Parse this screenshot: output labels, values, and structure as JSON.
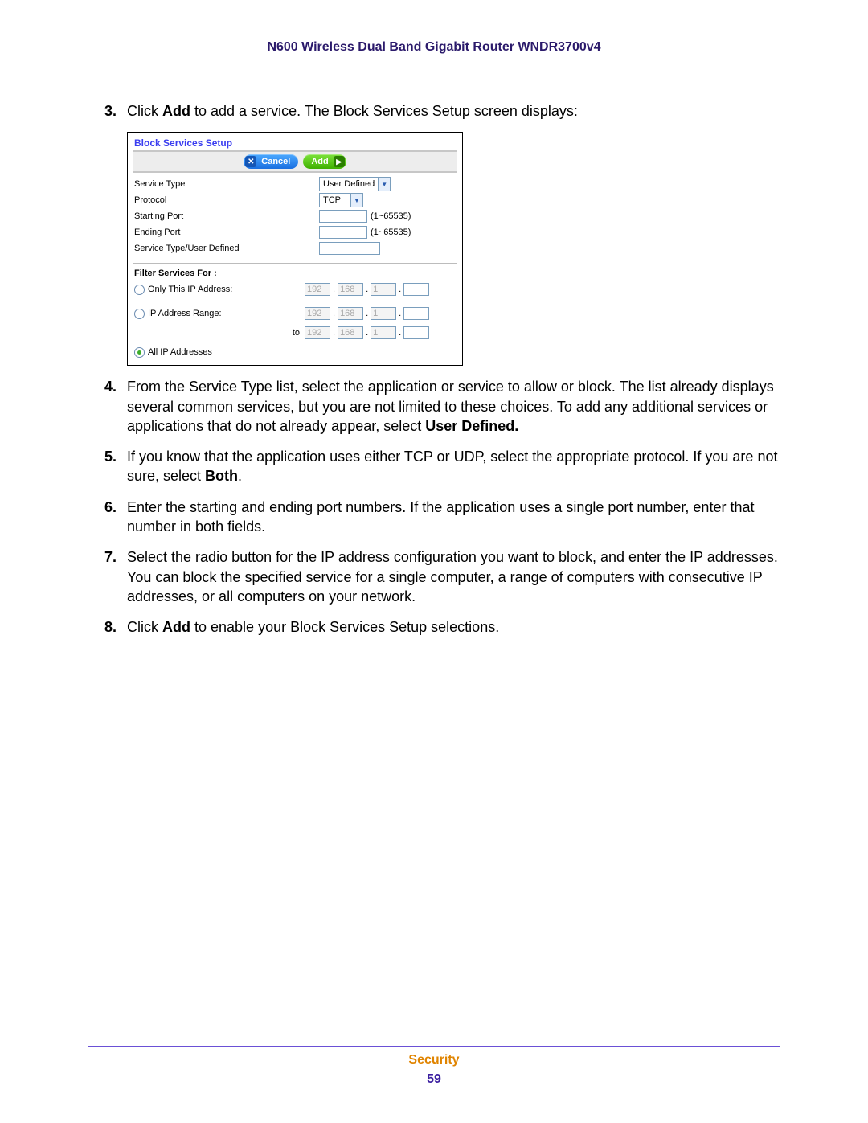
{
  "header": {
    "title": "N600 Wireless Dual Band Gigabit Router WNDR3700v4"
  },
  "steps": {
    "s3": {
      "num": "3.",
      "pre": "Click ",
      "bold": "Add",
      "post": " to add a service. The Block Services Setup screen displays:"
    },
    "s4": {
      "num": "4.",
      "pre": "From the Service Type list, select the application or service to allow or block. The list already displays several common services, but you are not limited to these choices. To add any additional services or applications that do not already appear, select ",
      "bold": "User Defined."
    },
    "s5": {
      "num": "5.",
      "pre": "If you know that the application uses either TCP or UDP, select the appropriate protocol. If you are not sure, select ",
      "bold": "Both",
      "post": "."
    },
    "s6": {
      "num": "6.",
      "text": "Enter the starting and ending port numbers. If the application uses a single port number, enter that number in both fields."
    },
    "s7": {
      "num": "7.",
      "text": "Select the radio button for the IP address configuration you want to block, and enter the IP addresses. You can block the specified service for a single computer, a range of computers with consecutive IP addresses, or all computers on your network."
    },
    "s8": {
      "num": "8.",
      "pre": "Click ",
      "bold": "Add",
      "post": " to enable your Block Services Setup selections."
    }
  },
  "panel": {
    "title": "Block Services Setup",
    "buttons": {
      "cancel": "Cancel",
      "add": "Add"
    },
    "rows": {
      "service_type": {
        "label": "Service Type",
        "value": "User Defined"
      },
      "protocol": {
        "label": "Protocol",
        "value": "TCP"
      },
      "start_port": {
        "label": "Starting Port",
        "hint": "(1~65535)"
      },
      "end_port": {
        "label": "Ending Port",
        "hint": "(1~65535)"
      },
      "user_defined": {
        "label": "Service Type/User Defined"
      }
    },
    "filter": {
      "title": "Filter Services For :",
      "opt1": "Only This IP Address:",
      "opt2": "IP Address Range:",
      "opt3": "All IP Addresses",
      "to": "to",
      "ip": {
        "a": "192",
        "b": "168",
        "c": "1"
      }
    }
  },
  "footer": {
    "chapter": "Security",
    "page": "59"
  }
}
